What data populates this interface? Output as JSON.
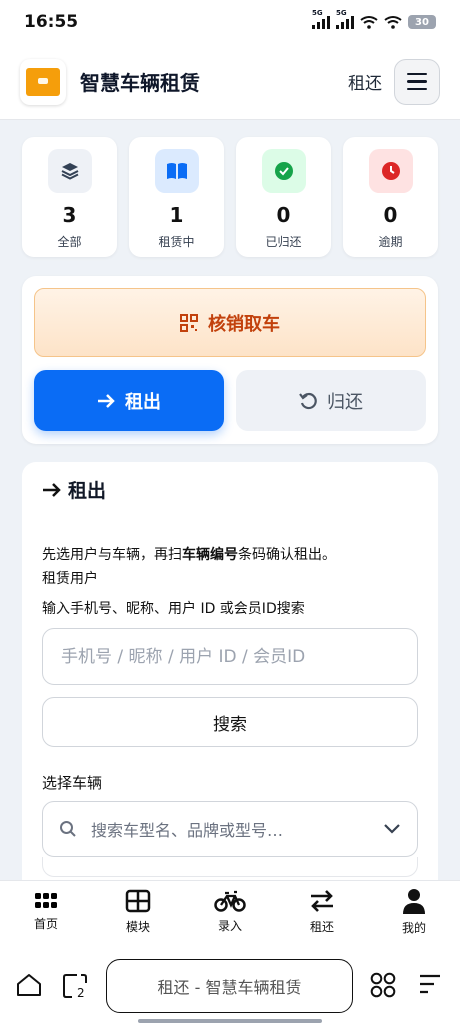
{
  "status_bar": {
    "time": "16:55",
    "signal1": "5G",
    "signal2": "5G",
    "battery": "30"
  },
  "app_bar": {
    "title": "智慧车辆租赁",
    "mode_label": "租还"
  },
  "stats": [
    {
      "value": "3",
      "label": "全部",
      "icon": "layers-icon",
      "color": "#334155"
    },
    {
      "value": "1",
      "label": "租赁中",
      "icon": "book-icon",
      "color": "#0a6cf5"
    },
    {
      "value": "0",
      "label": "已归还",
      "icon": "check-circle-icon",
      "color": "#16a34a"
    },
    {
      "value": "0",
      "label": "逾期",
      "icon": "clock-icon",
      "color": "#dc2626"
    }
  ],
  "actions": {
    "verify_label": "核销取车",
    "rent_tab": "租出",
    "return_tab": "归还"
  },
  "form": {
    "title": "租出",
    "desc_pre": "先选用户与车辆，再扫",
    "desc_bold": "车辆编号",
    "desc_post": "条码确认租出。",
    "user_section": "租赁用户",
    "user_hint": "输入手机号、昵称、用户 ID 或会员ID搜索",
    "phone_placeholder": "手机号 / 昵称 / 用户 ID / 会员ID",
    "search_label": "搜索",
    "vehicle_section": "选择车辆",
    "vehicle_placeholder": "搜索车型名、品牌或型号…"
  },
  "bottom_nav": [
    {
      "label": "首页",
      "icon": "home-grid-icon"
    },
    {
      "label": "模块",
      "icon": "modules-icon"
    },
    {
      "label": "录入",
      "icon": "bike-icon"
    },
    {
      "label": "租还",
      "icon": "swap-icon"
    },
    {
      "label": "我的",
      "icon": "user-icon"
    }
  ],
  "browser": {
    "url_text": "租还 - 智慧车辆租赁",
    "tab_count": "2"
  },
  "colors": {
    "primary": "#0a6cf5",
    "accent_orange": "#c2410c"
  }
}
